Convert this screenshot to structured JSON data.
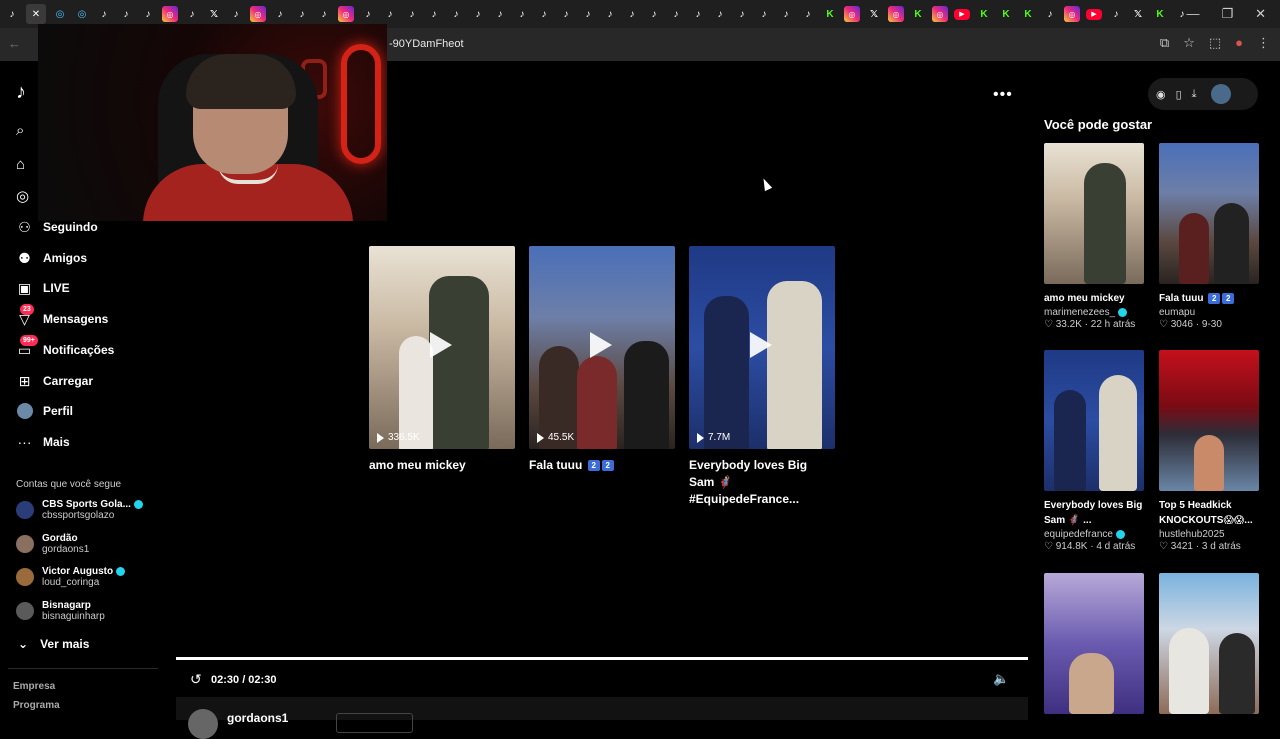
{
  "browser": {
    "url_fragment": "-90YDamFheot",
    "tab_icons": [
      "tiktok",
      "close",
      "edge",
      "edge",
      "tiktok",
      "tiktok",
      "tiktok",
      "instagram",
      "tiktok",
      "x",
      "tiktok",
      "instagram",
      "tiktok",
      "tiktok",
      "tiktok",
      "instagram",
      "tiktok",
      "tiktok",
      "tiktok",
      "tiktok",
      "tiktok",
      "tiktok",
      "tiktok",
      "tiktok",
      "tiktok",
      "tiktok",
      "tiktok",
      "tiktok",
      "tiktok",
      "tiktok",
      "tiktok",
      "tiktok",
      "tiktok",
      "tiktok",
      "tiktok",
      "tiktok",
      "tiktok",
      "kick",
      "instagram",
      "x",
      "instagram",
      "kick",
      "instagram",
      "youtube",
      "kick",
      "kick",
      "kick",
      "tiktok",
      "instagram",
      "youtube",
      "tiktok",
      "x",
      "kick",
      "tiktok",
      "plus"
    ],
    "window_controls": [
      "minimize",
      "restore",
      "close"
    ]
  },
  "sidebar": {
    "nav": [
      {
        "label": "Seguindo",
        "icon": "following-icon"
      },
      {
        "label": "Amigos",
        "icon": "friends-icon"
      },
      {
        "label": "LIVE",
        "icon": "live-icon"
      },
      {
        "label": "Mensagens",
        "icon": "messages-icon",
        "badge": "23"
      },
      {
        "label": "Notificações",
        "icon": "notifications-icon",
        "badge": "99+"
      },
      {
        "label": "Carregar",
        "icon": "upload-icon"
      },
      {
        "label": "Perfil",
        "icon": "profile-icon"
      },
      {
        "label": "Mais",
        "icon": "more-icon"
      }
    ],
    "following_title": "Contas que você segue",
    "accounts": [
      {
        "name": "CBS Sports Gola...",
        "handle": "cbssportsgolazo",
        "verified": true
      },
      {
        "name": "Gordão",
        "handle": "gordaons1",
        "verified": false
      },
      {
        "name": "Victor Augusto",
        "handle": "loud_coringa",
        "verified": true
      },
      {
        "name": "Bisnagarp",
        "handle": "bisnaguinharp",
        "verified": false
      }
    ],
    "see_more": "Ver mais",
    "footer": [
      "Empresa",
      "Programa"
    ]
  },
  "related": [
    {
      "title": "amo meu mickey",
      "views": "336.5K"
    },
    {
      "title": "Fala tuuu",
      "views": "45.5K",
      "emoji": [
        "2",
        "2"
      ]
    },
    {
      "title": "Everybody loves Big Sam 🦸‍♂️ #EquipedeFrance...",
      "views": "7.7M"
    }
  ],
  "player": {
    "time": "02:30 / 02:30",
    "author": "gordaons1"
  },
  "suggestions": {
    "title": "Você pode gostar",
    "items": [
      {
        "title": "amo meu mickey",
        "author": "marimenezees_",
        "verified": true,
        "likes": "33.2K",
        "when": "22 h atrás"
      },
      {
        "title": "Fala tuuu",
        "emoji": [
          "2",
          "2"
        ],
        "author": "eumapu",
        "verified": false,
        "likes": "3046",
        "when": "9-30"
      },
      {
        "title": "Everybody loves Big Sam 🦸‍♂️ ...",
        "author": "equipedefrance",
        "verified": true,
        "likes": "914.8K",
        "when": "4 d atrás"
      },
      {
        "title": "Top 5 Headkick KNOCKOUTS😱😱...",
        "author": "hustlehub2025",
        "verified": false,
        "likes": "3421",
        "when": "3 d atrás"
      },
      {
        "title": "",
        "author": "",
        "likes": "",
        "when": ""
      },
      {
        "title": "",
        "author": "",
        "likes": "",
        "when": ""
      }
    ]
  },
  "colors": {
    "accent": "#fe2c55",
    "verified": "#20d5ec",
    "kick": "#53fc18"
  }
}
